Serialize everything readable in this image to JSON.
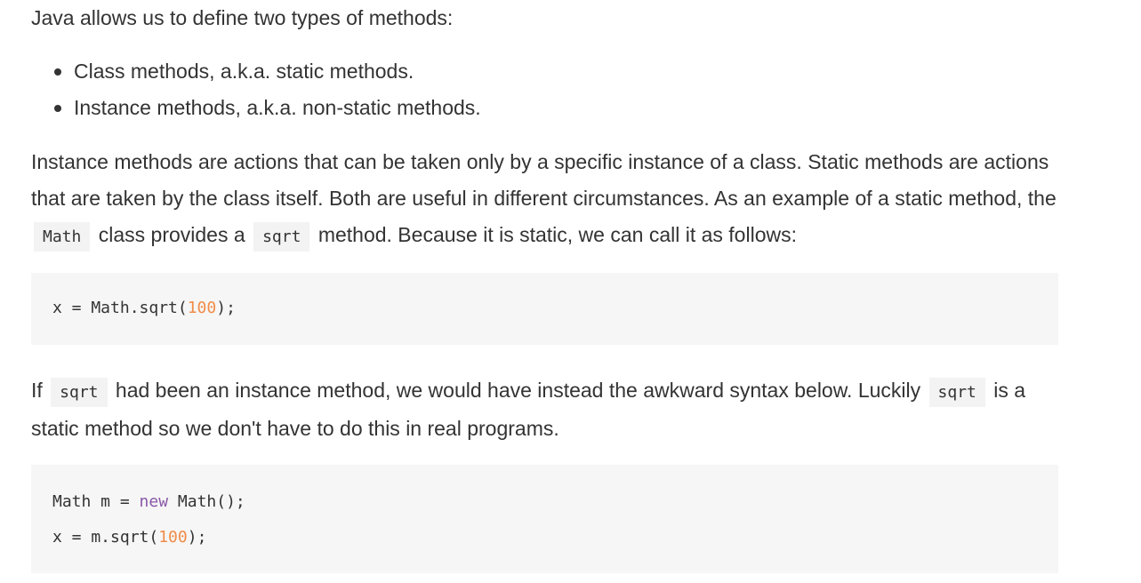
{
  "intro": "Java allows us to define two types of methods:",
  "method_types": [
    "Class methods, a.k.a. static methods.",
    "Instance methods, a.k.a. non-static methods."
  ],
  "para_instance": {
    "text1": "Instance methods are actions that can be taken only by a specific instance of a class. Static methods are actions that are taken by the class itself. Both are useful in different circumstances. As an example of a static method, the",
    "code1": "Math",
    "text2": "class provides a",
    "code2": "sqrt",
    "text3": "method. Because it is static, we can call it as follows:"
  },
  "code_block_1": {
    "line1_prefix": "x = Math.sqrt(",
    "line1_num": "100",
    "line1_suffix": ");"
  },
  "para_if": {
    "text1": "If",
    "code1": "sqrt",
    "text2": "had been an instance method, we would have instead the awkward syntax below. Luckily",
    "code2": "sqrt",
    "text3": "is a static method so we don't have to do this in real programs."
  },
  "code_block_2": {
    "line1_prefix": "Math m = ",
    "line1_kw": "new",
    "line1_suffix": " Math();",
    "line2_prefix": "x = m.sqrt(",
    "line2_num": "100",
    "line2_suffix": ");"
  }
}
